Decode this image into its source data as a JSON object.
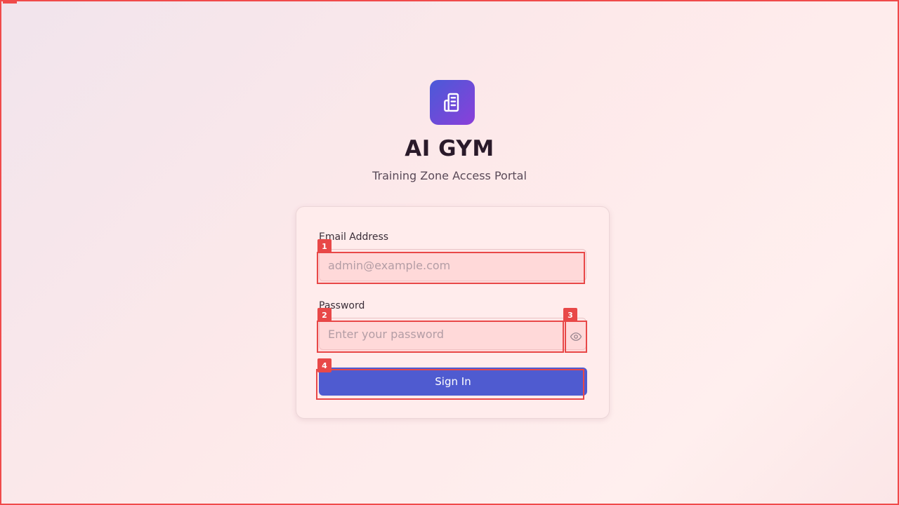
{
  "brand": {
    "title": "AI GYM",
    "subtitle": "Training Zone Access Portal",
    "logo_icon": "building-icon",
    "logo_gradient": [
      "#4a5ad8",
      "#8b3fd9"
    ]
  },
  "form": {
    "email_label": "Email Address",
    "email_placeholder": "admin@example.com",
    "email_value": "",
    "password_label": "Password",
    "password_placeholder": "Enter your password",
    "password_value": "",
    "toggle_icon": "eye-icon",
    "submit_label": "Sign In"
  },
  "annotations": {
    "badges": [
      "1",
      "2",
      "3",
      "4"
    ]
  },
  "colors": {
    "accent": "#4f5bd0",
    "highlight": "#e84848"
  }
}
